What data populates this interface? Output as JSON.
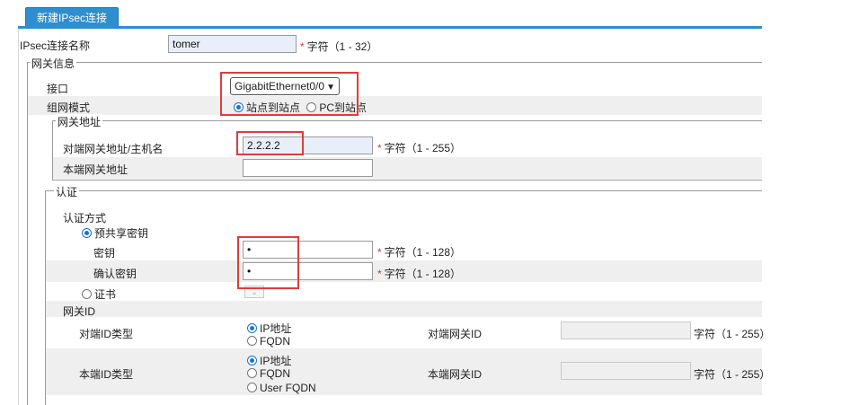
{
  "tab": {
    "label": "新建IPsec连接"
  },
  "connection_name": {
    "label": "IPsec连接名称",
    "value": "tomer",
    "hint": "字符（1 - 32）"
  },
  "gateway_info": {
    "legend": "网关信息",
    "interface": {
      "label": "接口",
      "selected": "GigabitEthernet0/0"
    },
    "network_mode": {
      "label": "组网模式",
      "options": [
        "站点到站点",
        "PC到站点"
      ],
      "selected_index": 0
    },
    "gateway_address": {
      "legend": "网关地址",
      "peer": {
        "label": "对端网关地址/主机名",
        "value": "2.2.2.2",
        "hint": "字符（1 - 255）"
      },
      "local": {
        "label": "本端网关地址",
        "value": ""
      }
    }
  },
  "auth": {
    "legend": "认证",
    "method_label": "认证方式",
    "psk_option": "预共享密钥",
    "key": {
      "label": "密钥",
      "value": "•",
      "hint": "字符（1 - 128）"
    },
    "confirm_key": {
      "label": "确认密钥",
      "value": "•",
      "hint": "字符（1 - 128）"
    },
    "cert_option": "证书",
    "gateway_id_label": "网关ID",
    "peer_id_type": {
      "label": "对端ID类型",
      "options": [
        "IP地址",
        "FQDN"
      ],
      "selected_index": 0
    },
    "peer_gateway_id": {
      "label": "对端网关ID",
      "value": "",
      "hint": "字符（1 - 255）"
    },
    "local_id_type": {
      "label": "本端ID类型",
      "options": [
        "IP地址",
        "FQDN",
        "User FQDN"
      ],
      "selected_index": 0
    },
    "local_gateway_id": {
      "label": "本端网关ID",
      "value": "",
      "hint": "字符（1 - 255）"
    }
  },
  "colors": {
    "tab": "#2d8fcf",
    "highlight_box": "#e03c3c",
    "required": "#e0322c"
  }
}
